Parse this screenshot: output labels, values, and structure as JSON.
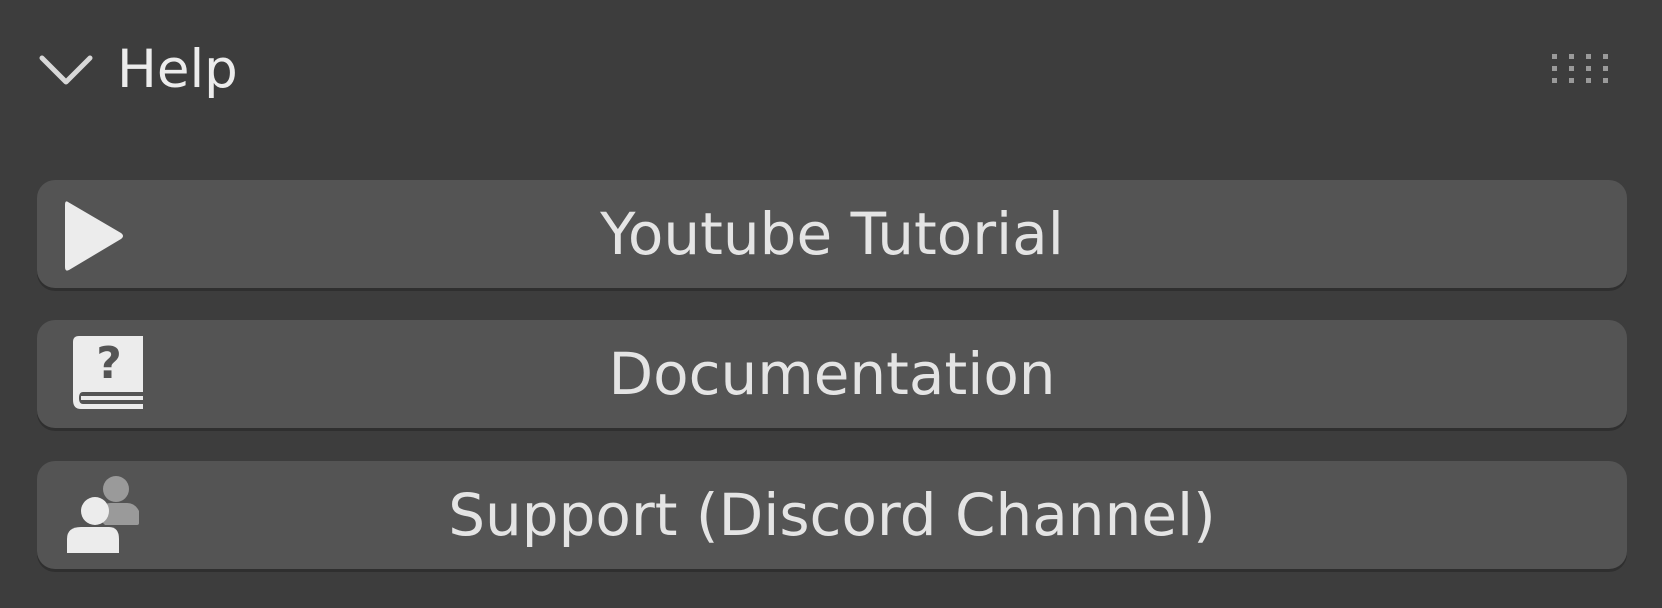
{
  "panel": {
    "title": "Help",
    "expanded": true,
    "toggle_icon": "chevron-down-icon",
    "drag_icon": "drag-handle-icon"
  },
  "buttons": [
    {
      "label": "Youtube Tutorial",
      "icon": "play-icon"
    },
    {
      "label": "Documentation",
      "icon": "help-book-icon"
    },
    {
      "label": "Support (Discord Channel)",
      "icon": "community-icon"
    }
  ],
  "colors": {
    "background": "#3d3d3d",
    "button": "#545454",
    "text": "#e4e4e4"
  }
}
